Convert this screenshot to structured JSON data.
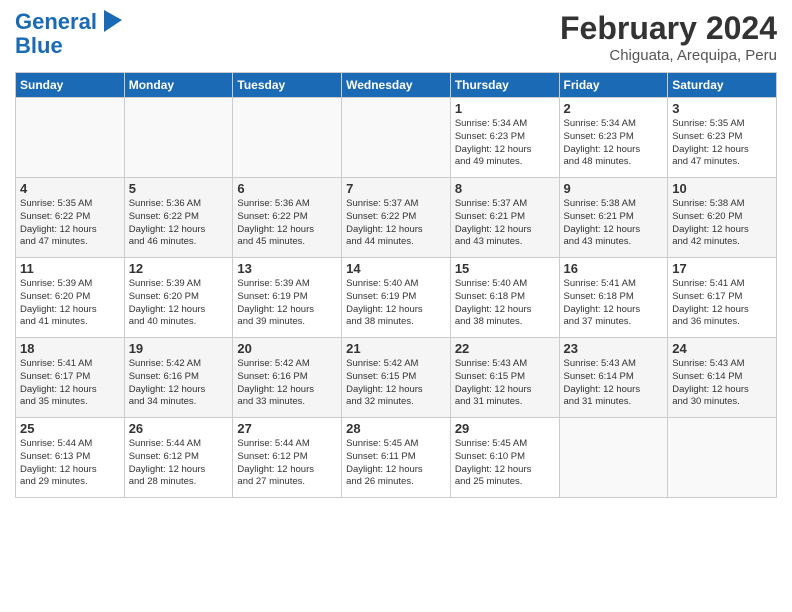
{
  "header": {
    "logo_line1": "General",
    "logo_line2": "Blue",
    "month_year": "February 2024",
    "location": "Chiguata, Arequipa, Peru"
  },
  "days_of_week": [
    "Sunday",
    "Monday",
    "Tuesday",
    "Wednesday",
    "Thursday",
    "Friday",
    "Saturday"
  ],
  "weeks": [
    [
      {
        "day": "",
        "info": ""
      },
      {
        "day": "",
        "info": ""
      },
      {
        "day": "",
        "info": ""
      },
      {
        "day": "",
        "info": ""
      },
      {
        "day": "1",
        "info": "Sunrise: 5:34 AM\nSunset: 6:23 PM\nDaylight: 12 hours\nand 49 minutes."
      },
      {
        "day": "2",
        "info": "Sunrise: 5:34 AM\nSunset: 6:23 PM\nDaylight: 12 hours\nand 48 minutes."
      },
      {
        "day": "3",
        "info": "Sunrise: 5:35 AM\nSunset: 6:23 PM\nDaylight: 12 hours\nand 47 minutes."
      }
    ],
    [
      {
        "day": "4",
        "info": "Sunrise: 5:35 AM\nSunset: 6:22 PM\nDaylight: 12 hours\nand 47 minutes."
      },
      {
        "day": "5",
        "info": "Sunrise: 5:36 AM\nSunset: 6:22 PM\nDaylight: 12 hours\nand 46 minutes."
      },
      {
        "day": "6",
        "info": "Sunrise: 5:36 AM\nSunset: 6:22 PM\nDaylight: 12 hours\nand 45 minutes."
      },
      {
        "day": "7",
        "info": "Sunrise: 5:37 AM\nSunset: 6:22 PM\nDaylight: 12 hours\nand 44 minutes."
      },
      {
        "day": "8",
        "info": "Sunrise: 5:37 AM\nSunset: 6:21 PM\nDaylight: 12 hours\nand 43 minutes."
      },
      {
        "day": "9",
        "info": "Sunrise: 5:38 AM\nSunset: 6:21 PM\nDaylight: 12 hours\nand 43 minutes."
      },
      {
        "day": "10",
        "info": "Sunrise: 5:38 AM\nSunset: 6:20 PM\nDaylight: 12 hours\nand 42 minutes."
      }
    ],
    [
      {
        "day": "11",
        "info": "Sunrise: 5:39 AM\nSunset: 6:20 PM\nDaylight: 12 hours\nand 41 minutes."
      },
      {
        "day": "12",
        "info": "Sunrise: 5:39 AM\nSunset: 6:20 PM\nDaylight: 12 hours\nand 40 minutes."
      },
      {
        "day": "13",
        "info": "Sunrise: 5:39 AM\nSunset: 6:19 PM\nDaylight: 12 hours\nand 39 minutes."
      },
      {
        "day": "14",
        "info": "Sunrise: 5:40 AM\nSunset: 6:19 PM\nDaylight: 12 hours\nand 38 minutes."
      },
      {
        "day": "15",
        "info": "Sunrise: 5:40 AM\nSunset: 6:18 PM\nDaylight: 12 hours\nand 38 minutes."
      },
      {
        "day": "16",
        "info": "Sunrise: 5:41 AM\nSunset: 6:18 PM\nDaylight: 12 hours\nand 37 minutes."
      },
      {
        "day": "17",
        "info": "Sunrise: 5:41 AM\nSunset: 6:17 PM\nDaylight: 12 hours\nand 36 minutes."
      }
    ],
    [
      {
        "day": "18",
        "info": "Sunrise: 5:41 AM\nSunset: 6:17 PM\nDaylight: 12 hours\nand 35 minutes."
      },
      {
        "day": "19",
        "info": "Sunrise: 5:42 AM\nSunset: 6:16 PM\nDaylight: 12 hours\nand 34 minutes."
      },
      {
        "day": "20",
        "info": "Sunrise: 5:42 AM\nSunset: 6:16 PM\nDaylight: 12 hours\nand 33 minutes."
      },
      {
        "day": "21",
        "info": "Sunrise: 5:42 AM\nSunset: 6:15 PM\nDaylight: 12 hours\nand 32 minutes."
      },
      {
        "day": "22",
        "info": "Sunrise: 5:43 AM\nSunset: 6:15 PM\nDaylight: 12 hours\nand 31 minutes."
      },
      {
        "day": "23",
        "info": "Sunrise: 5:43 AM\nSunset: 6:14 PM\nDaylight: 12 hours\nand 31 minutes."
      },
      {
        "day": "24",
        "info": "Sunrise: 5:43 AM\nSunset: 6:14 PM\nDaylight: 12 hours\nand 30 minutes."
      }
    ],
    [
      {
        "day": "25",
        "info": "Sunrise: 5:44 AM\nSunset: 6:13 PM\nDaylight: 12 hours\nand 29 minutes."
      },
      {
        "day": "26",
        "info": "Sunrise: 5:44 AM\nSunset: 6:12 PM\nDaylight: 12 hours\nand 28 minutes."
      },
      {
        "day": "27",
        "info": "Sunrise: 5:44 AM\nSunset: 6:12 PM\nDaylight: 12 hours\nand 27 minutes."
      },
      {
        "day": "28",
        "info": "Sunrise: 5:45 AM\nSunset: 6:11 PM\nDaylight: 12 hours\nand 26 minutes."
      },
      {
        "day": "29",
        "info": "Sunrise: 5:45 AM\nSunset: 6:10 PM\nDaylight: 12 hours\nand 25 minutes."
      },
      {
        "day": "",
        "info": ""
      },
      {
        "day": "",
        "info": ""
      }
    ]
  ]
}
